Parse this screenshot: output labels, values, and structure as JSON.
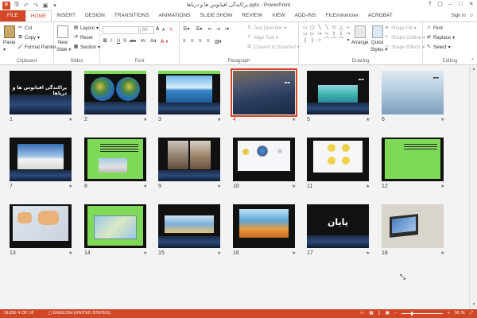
{
  "app": {
    "title": "براکندگی اقیانوس ها و دریاها.pptx - PowerPoint",
    "icon_text": "P"
  },
  "qat": [
    "save-icon",
    "undo-icon",
    "redo-icon",
    "start-slideshow-icon",
    "customize-icon"
  ],
  "window_controls": [
    "?",
    "▢",
    "–",
    "□",
    "✕"
  ],
  "tabs": [
    "FILE",
    "HOME",
    "INSERT",
    "DESIGN",
    "TRANSITIONS",
    "ANIMATIONS",
    "SLIDE SHOW",
    "REVIEW",
    "VIEW",
    "ADD-INS",
    "FILEminimizer",
    "ACROBAT"
  ],
  "active_tab": "HOME",
  "signin": "Sign in",
  "ribbon": {
    "clipboard": {
      "label": "Clipboard",
      "paste": "Paste",
      "cut": "Cut",
      "copy": "Copy",
      "format_painter": "Format Painter"
    },
    "slides": {
      "label": "Slides",
      "new_slide": "New",
      "new_slide_2": "Slide",
      "layout": "Layout",
      "reset": "Reset",
      "section": "Section"
    },
    "font": {
      "label": "Font",
      "size": "60",
      "bold": "B",
      "italic": "I",
      "underline": "U",
      "strike": "S",
      "shadow": "abc",
      "spacing": "AV",
      "case": "Aa",
      "grow": "A",
      "shrink": "A"
    },
    "paragraph": {
      "label": "Paragraph",
      "text_direction": "Text Direction",
      "align_text": "Align Text",
      "convert_smartart": "Convert to SmartArt"
    },
    "drawing": {
      "label": "Drawing",
      "arrange": "Arrange",
      "quick_styles": "Quick",
      "quick_styles_2": "Styles",
      "shape_fill": "Shape Fill",
      "shape_outline": "Shape Outline",
      "shape_effects": "Shape Effects",
      "shapes": [
        "▭",
        "▢",
        "╲",
        "╲",
        "⬭",
        "△",
        "⌐",
        "▭",
        "▷",
        "↪",
        "⇨",
        "⇧",
        "⇩",
        "⤳",
        "{",
        "}",
        "☆",
        "⌒",
        "⌒",
        "⌒",
        "▾"
      ]
    },
    "editing": {
      "label": "Editing",
      "find": "Find",
      "replace": "Replace",
      "select": "Select"
    }
  },
  "slides": [
    {
      "num": "1",
      "title": "پراکندگی اقیانوس ها و دریاها"
    },
    {
      "num": "2",
      "title": ""
    },
    {
      "num": "3",
      "title": ""
    },
    {
      "num": "4",
      "title": ""
    },
    {
      "num": "5",
      "title": ""
    },
    {
      "num": "6",
      "title": ""
    },
    {
      "num": "7",
      "title": ""
    },
    {
      "num": "8",
      "title": ""
    },
    {
      "num": "9",
      "title": ""
    },
    {
      "num": "10",
      "title": ""
    },
    {
      "num": "11",
      "title": ""
    },
    {
      "num": "12",
      "title": ""
    },
    {
      "num": "13",
      "title": ""
    },
    {
      "num": "14",
      "title": ""
    },
    {
      "num": "15",
      "title": ""
    },
    {
      "num": "16",
      "title": ""
    },
    {
      "num": "17",
      "title": "پایان"
    },
    {
      "num": "18",
      "title": ""
    }
  ],
  "selected_slide": "4",
  "star": "★",
  "status": {
    "slide_info": "SLIDE 4 OF 18",
    "language": "ENGLISH (UNITED STATES)",
    "zoom": "55 %",
    "zoom_level": 0.55
  },
  "colors": {
    "accent": "#d24726",
    "green_banner": "#7ed957"
  }
}
